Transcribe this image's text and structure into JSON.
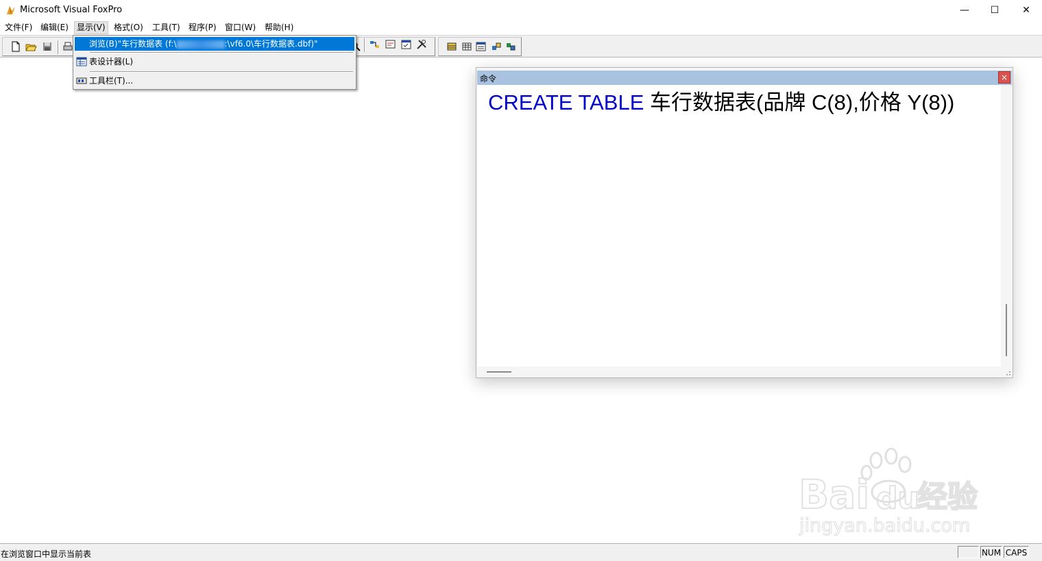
{
  "window": {
    "title": "Microsoft Visual FoxPro",
    "minimize_glyph": "—",
    "maximize_glyph": "☐",
    "close_glyph": "✕"
  },
  "menubar": {
    "items": [
      {
        "label": "文件(F)"
      },
      {
        "label": "编辑(E)"
      },
      {
        "label": "显示(V)"
      },
      {
        "label": "格式(O)"
      },
      {
        "label": "工具(T)"
      },
      {
        "label": "程序(P)"
      },
      {
        "label": "窗口(W)"
      },
      {
        "label": "帮助(H)"
      }
    ]
  },
  "dropdown": {
    "items": [
      {
        "label_prefix": "浏览(B)\"车行数据表 (f:\\",
        "label_suffix": ":\\vf6.0\\车行数据表.dbf)\"",
        "icon": "browse-icon"
      },
      {
        "label": "表设计器(L)",
        "icon": "table-designer-icon"
      },
      {
        "label": "工具栏(T)...",
        "icon": "toolbar-icon"
      }
    ]
  },
  "command_window": {
    "title": "命令",
    "close_glyph": "×",
    "command_keyword": "CREATE TABLE",
    "command_rest": " 车行数据表(品牌 C(8),价格 Y(8))"
  },
  "statusbar": {
    "message": "在浏览窗口中显示当前表",
    "num": "NUM",
    "caps": "CAPS"
  },
  "watermark": {
    "text": "Bai",
    "text2": "du",
    "text3": "经验",
    "url": "jingyan.baidu.com"
  },
  "colors": {
    "highlight": "#0078d7",
    "keyword": "#0000cc",
    "cmd_title": "#a9c2e0"
  }
}
